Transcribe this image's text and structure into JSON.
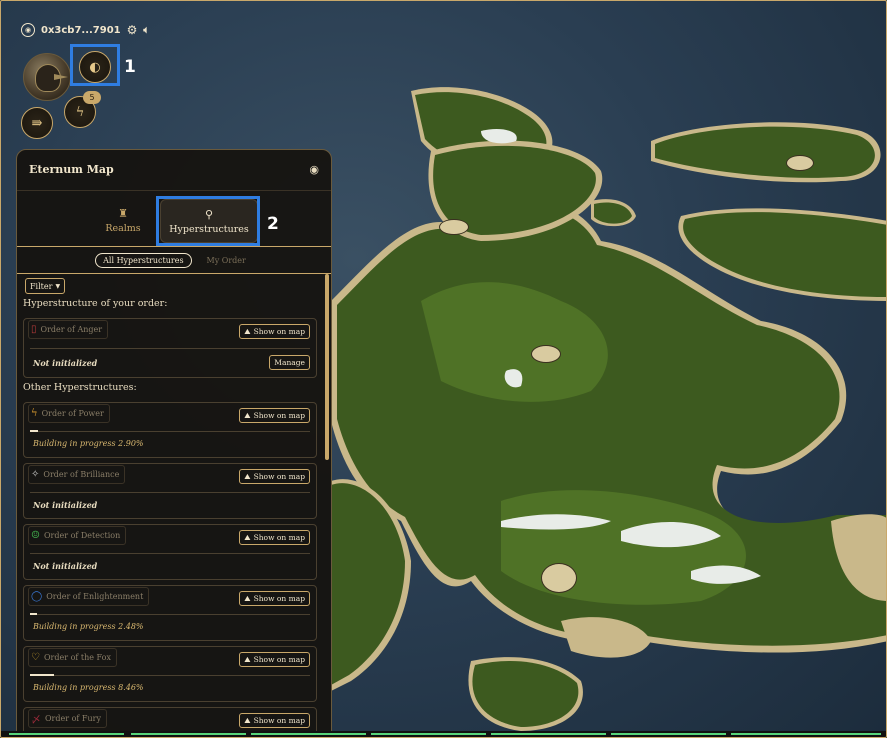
{
  "header": {
    "account": "0x3cb7...7901",
    "icons": {
      "account_icon": "globe-circle-icon",
      "settings_icon": "gear-icon",
      "sound_icon": "speaker-icon"
    }
  },
  "hud": {
    "energy_badge": "5",
    "step1": "1",
    "step2": "2"
  },
  "panel": {
    "title": "Eternum Map",
    "tabs": [
      {
        "label": "Realms",
        "icon": "castle-icon"
      },
      {
        "label": "Hyperstructures",
        "icon": "pin-icon"
      }
    ],
    "subtabs": [
      "All Hyperstructures",
      "My Order"
    ],
    "filter_label": "Filter",
    "your_order_heading": "Hyperstructure of your order:",
    "other_heading": "Other Hyperstructures:",
    "show_on_map": "Show on map",
    "manage": "Manage",
    "your_order": {
      "name": "Order of Anger",
      "status": "Not initialized",
      "progress": 0,
      "color": "#b33a3a"
    },
    "others": [
      {
        "name": "Order of Power",
        "status": "Building in progress 2.90%",
        "progress": 2.9,
        "color": "#e0a030"
      },
      {
        "name": "Order of Brilliance",
        "status": "Not initialized",
        "progress": 0,
        "color": "#c8c8c8"
      },
      {
        "name": "Order of Detection",
        "status": "Not initialized",
        "progress": 0,
        "color": "#3fa84a"
      },
      {
        "name": "Order of Enlightenment",
        "status": "Building in progress 2.48%",
        "progress": 2.48,
        "color": "#3a7ad9"
      },
      {
        "name": "Order of the Fox",
        "status": "Building in progress 8.46%",
        "progress": 8.46,
        "color": "#c9a030"
      },
      {
        "name": "Order of Fury",
        "status": "",
        "progress": 0,
        "color": "#9a2a3a"
      }
    ]
  },
  "colors": {
    "accent": "#c9a86a",
    "highlight": "#2f7de1",
    "progress_ok": "#57d47a"
  }
}
